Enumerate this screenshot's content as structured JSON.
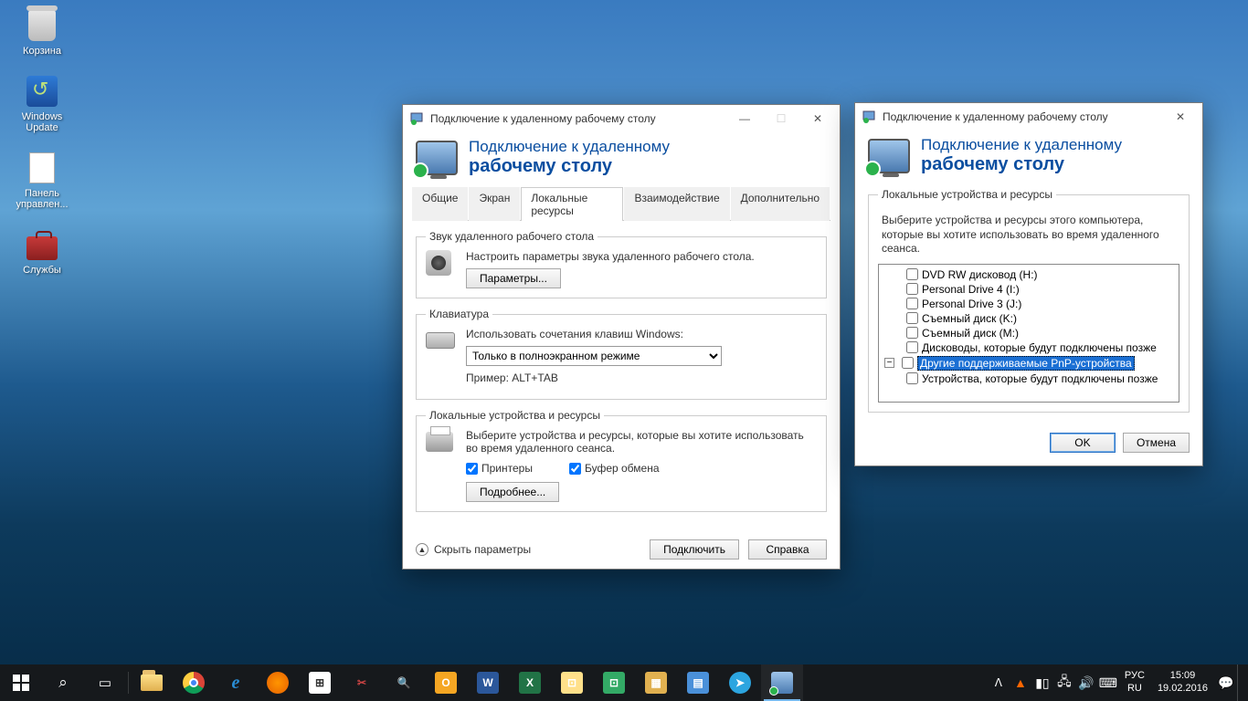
{
  "desktop": {
    "icons": [
      "Корзина",
      "Windows Update",
      "Панель управлен...",
      "Службы"
    ]
  },
  "rdp_window": {
    "title": "Подключение к удаленному рабочему столу",
    "header_line1": "Подключение к удаленному",
    "header_line2": "рабочему столу",
    "tabs": [
      "Общие",
      "Экран",
      "Локальные ресурсы",
      "Взаимодействие",
      "Дополнительно"
    ],
    "audio": {
      "legend": "Звук удаленного рабочего стола",
      "desc": "Настроить параметры звука удаленного рабочего стола.",
      "btn": "Параметры..."
    },
    "keyboard": {
      "legend": "Клавиатура",
      "desc": "Использовать сочетания клавиш Windows:",
      "combo": "Только в полноэкранном режиме",
      "example_lbl": "Пример: ALT+TAB"
    },
    "local": {
      "legend": "Локальные устройства и ресурсы",
      "desc": "Выберите устройства и ресурсы, которые вы хотите использовать во время удаленного сеанса.",
      "chk_printers": "Принтеры",
      "chk_clipboard": "Буфер обмена",
      "btn": "Подробнее..."
    },
    "collapse": "Скрыть параметры",
    "connect_btn": "Подключить",
    "help_btn": "Справка"
  },
  "devices_dialog": {
    "title": "Подключение к удаленному рабочему столу",
    "legend": "Локальные устройства и ресурсы",
    "desc": "Выберите устройства и ресурсы этого компьютера, которые вы хотите использовать во время удаленного сеанса.",
    "items": [
      "DVD RW дисковод (H:)",
      "Personal Drive 4 (I:)",
      "Personal Drive 3 (J:)",
      "Съемный диск (K:)",
      "Съемный диск (M:)",
      "Дисководы, которые будут подключены позже"
    ],
    "selected": "Другие поддерживаемые PnP-устройства",
    "sub_item": "Устройства, которые будут подключены позже",
    "ok": "OK",
    "cancel": "Отмена"
  },
  "taskbar": {
    "lang1": "РУС",
    "lang2": "RU",
    "time": "15:09",
    "date": "19.02.2016"
  }
}
